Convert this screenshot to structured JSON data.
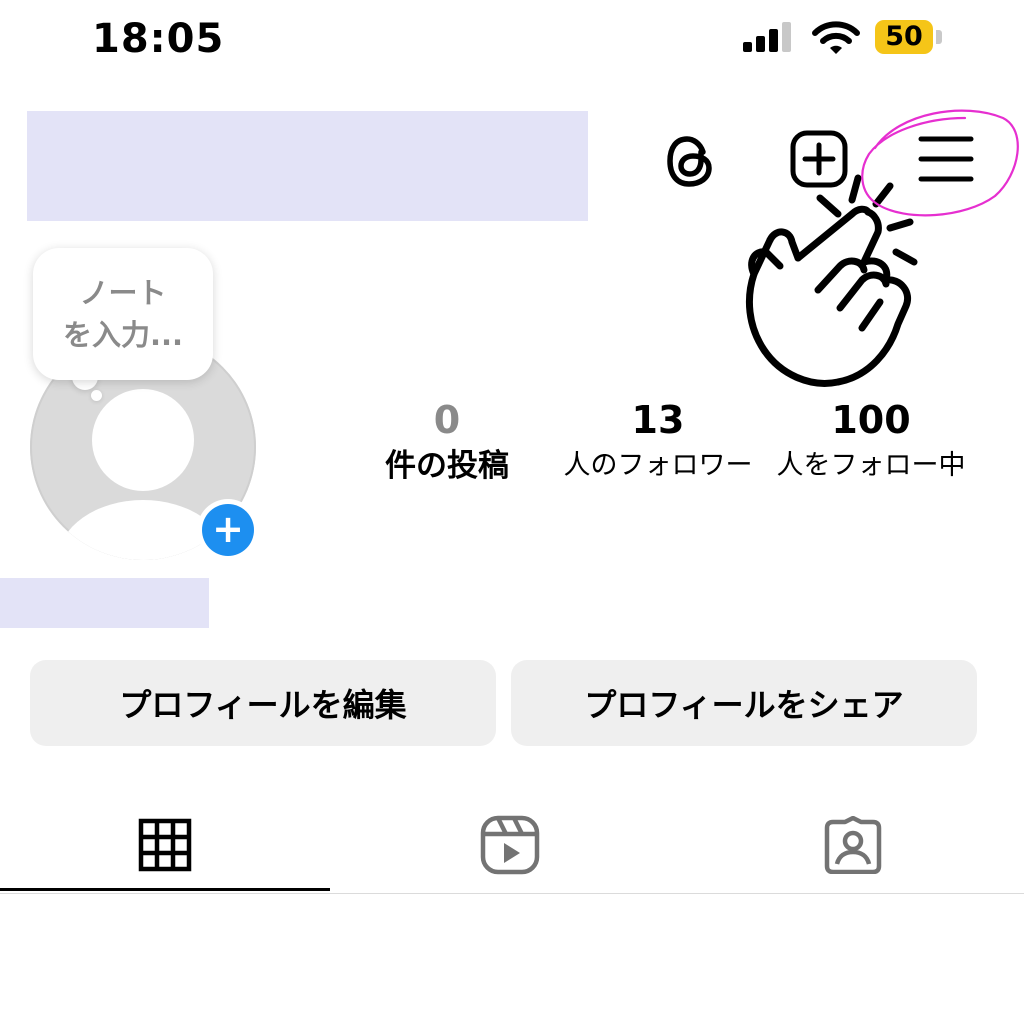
{
  "status_bar": {
    "time": "18:05",
    "battery": "50",
    "icons": [
      "signal-icon",
      "wifi-icon",
      "battery-icon"
    ]
  },
  "header": {
    "icons": [
      "threads-icon",
      "create-plus-icon",
      "hamburger-menu-icon"
    ]
  },
  "note": {
    "placeholder": "ノート\nを入力..."
  },
  "profile": {
    "add_story_icon": "plus-icon"
  },
  "stats": {
    "posts_count": "0",
    "posts_label": "件の投稿",
    "followers_count": "13",
    "followers_label": "人のフォロワー",
    "following_count": "100",
    "following_label": "人をフォロー中"
  },
  "buttons": {
    "edit_profile": "プロフィールを編集",
    "share_profile": "プロフィールをシェア"
  },
  "tabs": [
    {
      "icon": "grid-icon",
      "active": true
    },
    {
      "icon": "reels-icon",
      "active": false
    },
    {
      "icon": "tagged-icon",
      "active": false
    }
  ],
  "annotation": {
    "color": "#e62fd0",
    "icon": "pointing-hand-icon"
  },
  "colors": {
    "accent_blue": "#1d8ff0",
    "battery_yellow": "#f5c518",
    "button_bg": "#efefef"
  }
}
